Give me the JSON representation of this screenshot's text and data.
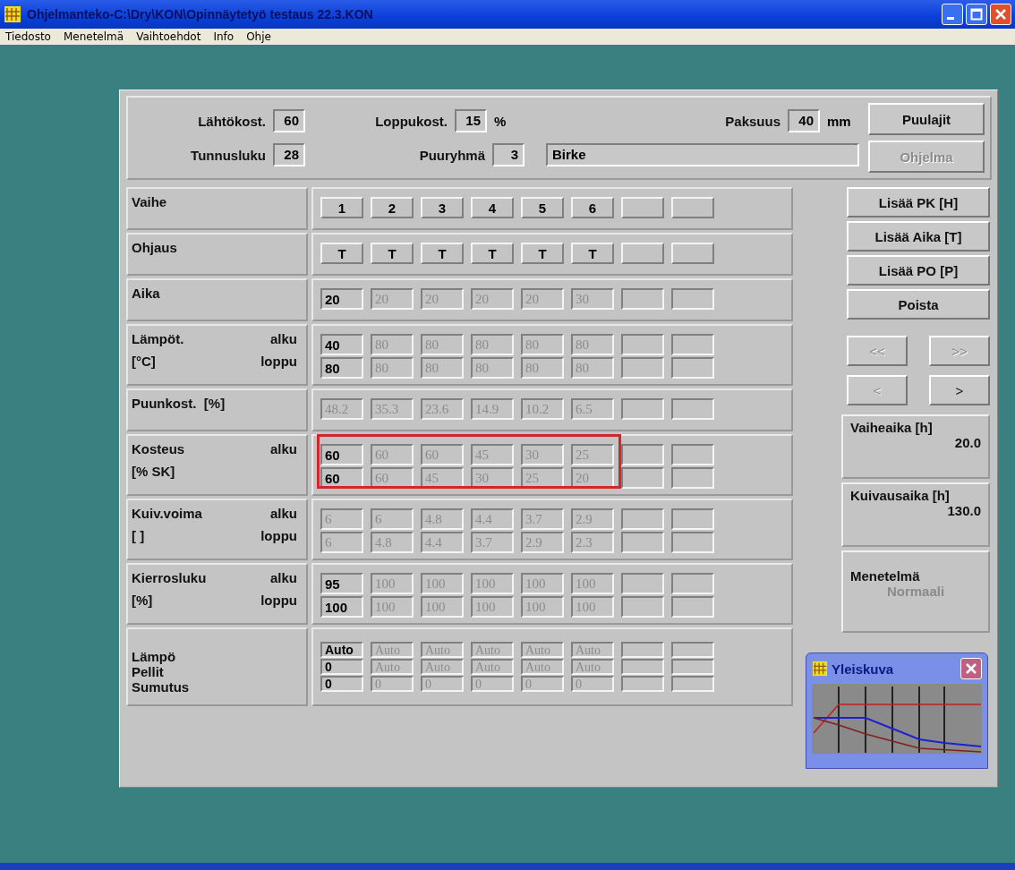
{
  "window": {
    "title": "Ohjelmanteko-C:\\Dry\\KON\\Opinnäytetyö testaus 22.3.KON"
  },
  "menu": [
    "Tiedosto",
    "Menetelmä",
    "Vaihtoehdot",
    "Info",
    "Ohje"
  ],
  "top": {
    "rows": [
      [
        {
          "label": "Lähtökost.",
          "value": "60"
        },
        {
          "label": "Loppukost.",
          "value": "15",
          "unit": "%"
        },
        {
          "label": "Paksuus",
          "value": "40",
          "unit": "mm"
        }
      ],
      [
        {
          "label": "Tunnusluku",
          "value": "28"
        },
        {
          "label": "Puuryhmä",
          "value": "3"
        },
        {
          "value": "Birke",
          "kind": "wide"
        }
      ]
    ],
    "buttons": [
      {
        "label": "Puulajit",
        "disabled": false
      },
      {
        "label": "Ohjelma",
        "disabled": true
      }
    ]
  },
  "grid": [
    {
      "kind": "header",
      "highlighted": false,
      "labels": [
        {
          "left": "Vaihe"
        }
      ],
      "lines": [
        [
          {
            "text": "1",
            "disabled": false
          },
          {
            "text": "2",
            "disabled": false
          },
          {
            "text": "3",
            "disabled": false
          },
          {
            "text": "4",
            "disabled": false
          },
          {
            "text": "5",
            "disabled": false
          },
          {
            "text": "6",
            "disabled": false
          }
        ]
      ]
    },
    {
      "kind": "header",
      "highlighted": false,
      "labels": [
        {
          "left": "Ohjaus"
        }
      ],
      "lines": [
        [
          {
            "text": "T",
            "disabled": false
          },
          {
            "text": "T",
            "disabled": false
          },
          {
            "text": "T",
            "disabled": false
          },
          {
            "text": "T",
            "disabled": false
          },
          {
            "text": "T",
            "disabled": false
          },
          {
            "text": "T",
            "disabled": false
          }
        ]
      ]
    },
    {
      "kind": "input",
      "highlighted": false,
      "labels": [
        {
          "left": "Aika"
        }
      ],
      "lines": [
        [
          {
            "text": "20",
            "disabled": false
          },
          {
            "text": "20",
            "disabled": true
          },
          {
            "text": "20",
            "disabled": true
          },
          {
            "text": "20",
            "disabled": true
          },
          {
            "text": "20",
            "disabled": true
          },
          {
            "text": "30",
            "disabled": true
          }
        ]
      ]
    },
    {
      "kind": "input",
      "highlighted": false,
      "labels": [
        {
          "left": "Lämpöt.",
          "right": "alku"
        },
        {
          "left": "[°C]",
          "right": "loppu"
        }
      ],
      "lines": [
        [
          {
            "text": "40",
            "disabled": false
          },
          {
            "text": "80",
            "disabled": true
          },
          {
            "text": "80",
            "disabled": true
          },
          {
            "text": "80",
            "disabled": true
          },
          {
            "text": "80",
            "disabled": true
          },
          {
            "text": "80",
            "disabled": true
          }
        ],
        [
          {
            "text": "80",
            "disabled": false
          },
          {
            "text": "80",
            "disabled": true
          },
          {
            "text": "80",
            "disabled": true
          },
          {
            "text": "80",
            "disabled": true
          },
          {
            "text": "80",
            "disabled": true
          },
          {
            "text": "80",
            "disabled": true
          }
        ]
      ]
    },
    {
      "kind": "input",
      "highlighted": false,
      "labels": [
        {
          "left": "Puunkost.  [%]"
        }
      ],
      "lines": [
        [
          {
            "text": "48.2",
            "disabled": true
          },
          {
            "text": "35.3",
            "disabled": true
          },
          {
            "text": "23.6",
            "disabled": true
          },
          {
            "text": "14.9",
            "disabled": true
          },
          {
            "text": "10.2",
            "disabled": true
          },
          {
            "text": "6.5",
            "disabled": true
          }
        ]
      ]
    },
    {
      "kind": "input",
      "highlighted": true,
      "labels": [
        {
          "left": "Kosteus",
          "right": "alku"
        },
        {
          "left": "[% SK]"
        }
      ],
      "lines": [
        [
          {
            "text": "60",
            "disabled": false
          },
          {
            "text": "60",
            "disabled": true
          },
          {
            "text": "60",
            "disabled": true
          },
          {
            "text": "45",
            "disabled": true
          },
          {
            "text": "30",
            "disabled": true
          },
          {
            "text": "25",
            "disabled": true
          }
        ],
        [
          {
            "text": "60",
            "disabled": false
          },
          {
            "text": "60",
            "disabled": true
          },
          {
            "text": "45",
            "disabled": true
          },
          {
            "text": "30",
            "disabled": true
          },
          {
            "text": "25",
            "disabled": true
          },
          {
            "text": "20",
            "disabled": true
          }
        ]
      ]
    },
    {
      "kind": "input",
      "highlighted": false,
      "labels": [
        {
          "left": "Kuiv.voima",
          "right": "alku"
        },
        {
          "left": "[ ]",
          "right": "loppu"
        }
      ],
      "lines": [
        [
          {
            "text": "6",
            "disabled": true
          },
          {
            "text": "6",
            "disabled": true
          },
          {
            "text": "4.8",
            "disabled": true
          },
          {
            "text": "4.4",
            "disabled": true
          },
          {
            "text": "3.7",
            "disabled": true
          },
          {
            "text": "2.9",
            "disabled": true
          }
        ],
        [
          {
            "text": "6",
            "disabled": true
          },
          {
            "text": "4.8",
            "disabled": true
          },
          {
            "text": "4.4",
            "disabled": true
          },
          {
            "text": "3.7",
            "disabled": true
          },
          {
            "text": "2.9",
            "disabled": true
          },
          {
            "text": "2.3",
            "disabled": true
          }
        ]
      ]
    },
    {
      "kind": "input",
      "highlighted": false,
      "labels": [
        {
          "left": "Kierrosluku",
          "right": "alku"
        },
        {
          "left": "[%]",
          "right": "loppu"
        }
      ],
      "lines": [
        [
          {
            "text": "95",
            "disabled": false
          },
          {
            "text": "100",
            "disabled": true
          },
          {
            "text": "100",
            "disabled": true
          },
          {
            "text": "100",
            "disabled": true
          },
          {
            "text": "100",
            "disabled": true
          },
          {
            "text": "100",
            "disabled": true
          }
        ],
        [
          {
            "text": "100",
            "disabled": false
          },
          {
            "text": "100",
            "disabled": true
          },
          {
            "text": "100",
            "disabled": true
          },
          {
            "text": "100",
            "disabled": true
          },
          {
            "text": "100",
            "disabled": true
          },
          {
            "text": "100",
            "disabled": true
          }
        ]
      ]
    },
    {
      "kind": "compact",
      "highlighted": false,
      "labels": [
        {
          "left": "Lämpö"
        },
        {
          "left": "Pellit"
        },
        {
          "left": "Sumutus"
        }
      ],
      "lines": [
        [
          {
            "text": "Auto",
            "disabled": false
          },
          {
            "text": "Auto",
            "disabled": true
          },
          {
            "text": "Auto",
            "disabled": true
          },
          {
            "text": "Auto",
            "disabled": true
          },
          {
            "text": "Auto",
            "disabled": true
          },
          {
            "text": "Auto",
            "disabled": true
          }
        ],
        [
          {
            "text": "0",
            "disabled": false
          },
          {
            "text": "Auto",
            "disabled": true
          },
          {
            "text": "Auto",
            "disabled": true
          },
          {
            "text": "Auto",
            "disabled": true
          },
          {
            "text": "Auto",
            "disabled": true
          },
          {
            "text": "Auto",
            "disabled": true
          }
        ],
        [
          {
            "text": "0",
            "disabled": false
          },
          {
            "text": "0",
            "disabled": true
          },
          {
            "text": "0",
            "disabled": true
          },
          {
            "text": "0",
            "disabled": true
          },
          {
            "text": "0",
            "disabled": true
          },
          {
            "text": "0",
            "disabled": true
          }
        ]
      ]
    }
  ],
  "actions": [
    {
      "label": "Lisää PK [H]",
      "disabled": false
    },
    {
      "label": "Lisää Aika [T]",
      "disabled": false
    },
    {
      "label": "Lisää PO [P]",
      "disabled": false
    },
    {
      "label": "Poista",
      "disabled": false
    }
  ],
  "nav": [
    {
      "label": "<<",
      "disabled": true
    },
    {
      "label": ">>",
      "disabled": true
    },
    {
      "label": "<",
      "disabled": true
    },
    {
      "label": ">",
      "disabled": false
    }
  ],
  "info": [
    {
      "label": "Vaiheaika [h]",
      "value": "20.0",
      "disabled": false
    },
    {
      "label": "Kuivausaika [h]",
      "value": "130.0",
      "disabled": false
    },
    {
      "label": "Menetelmä",
      "value": "Normaali",
      "disabled": true
    }
  ],
  "overview": {
    "title": "Yleiskuva"
  }
}
